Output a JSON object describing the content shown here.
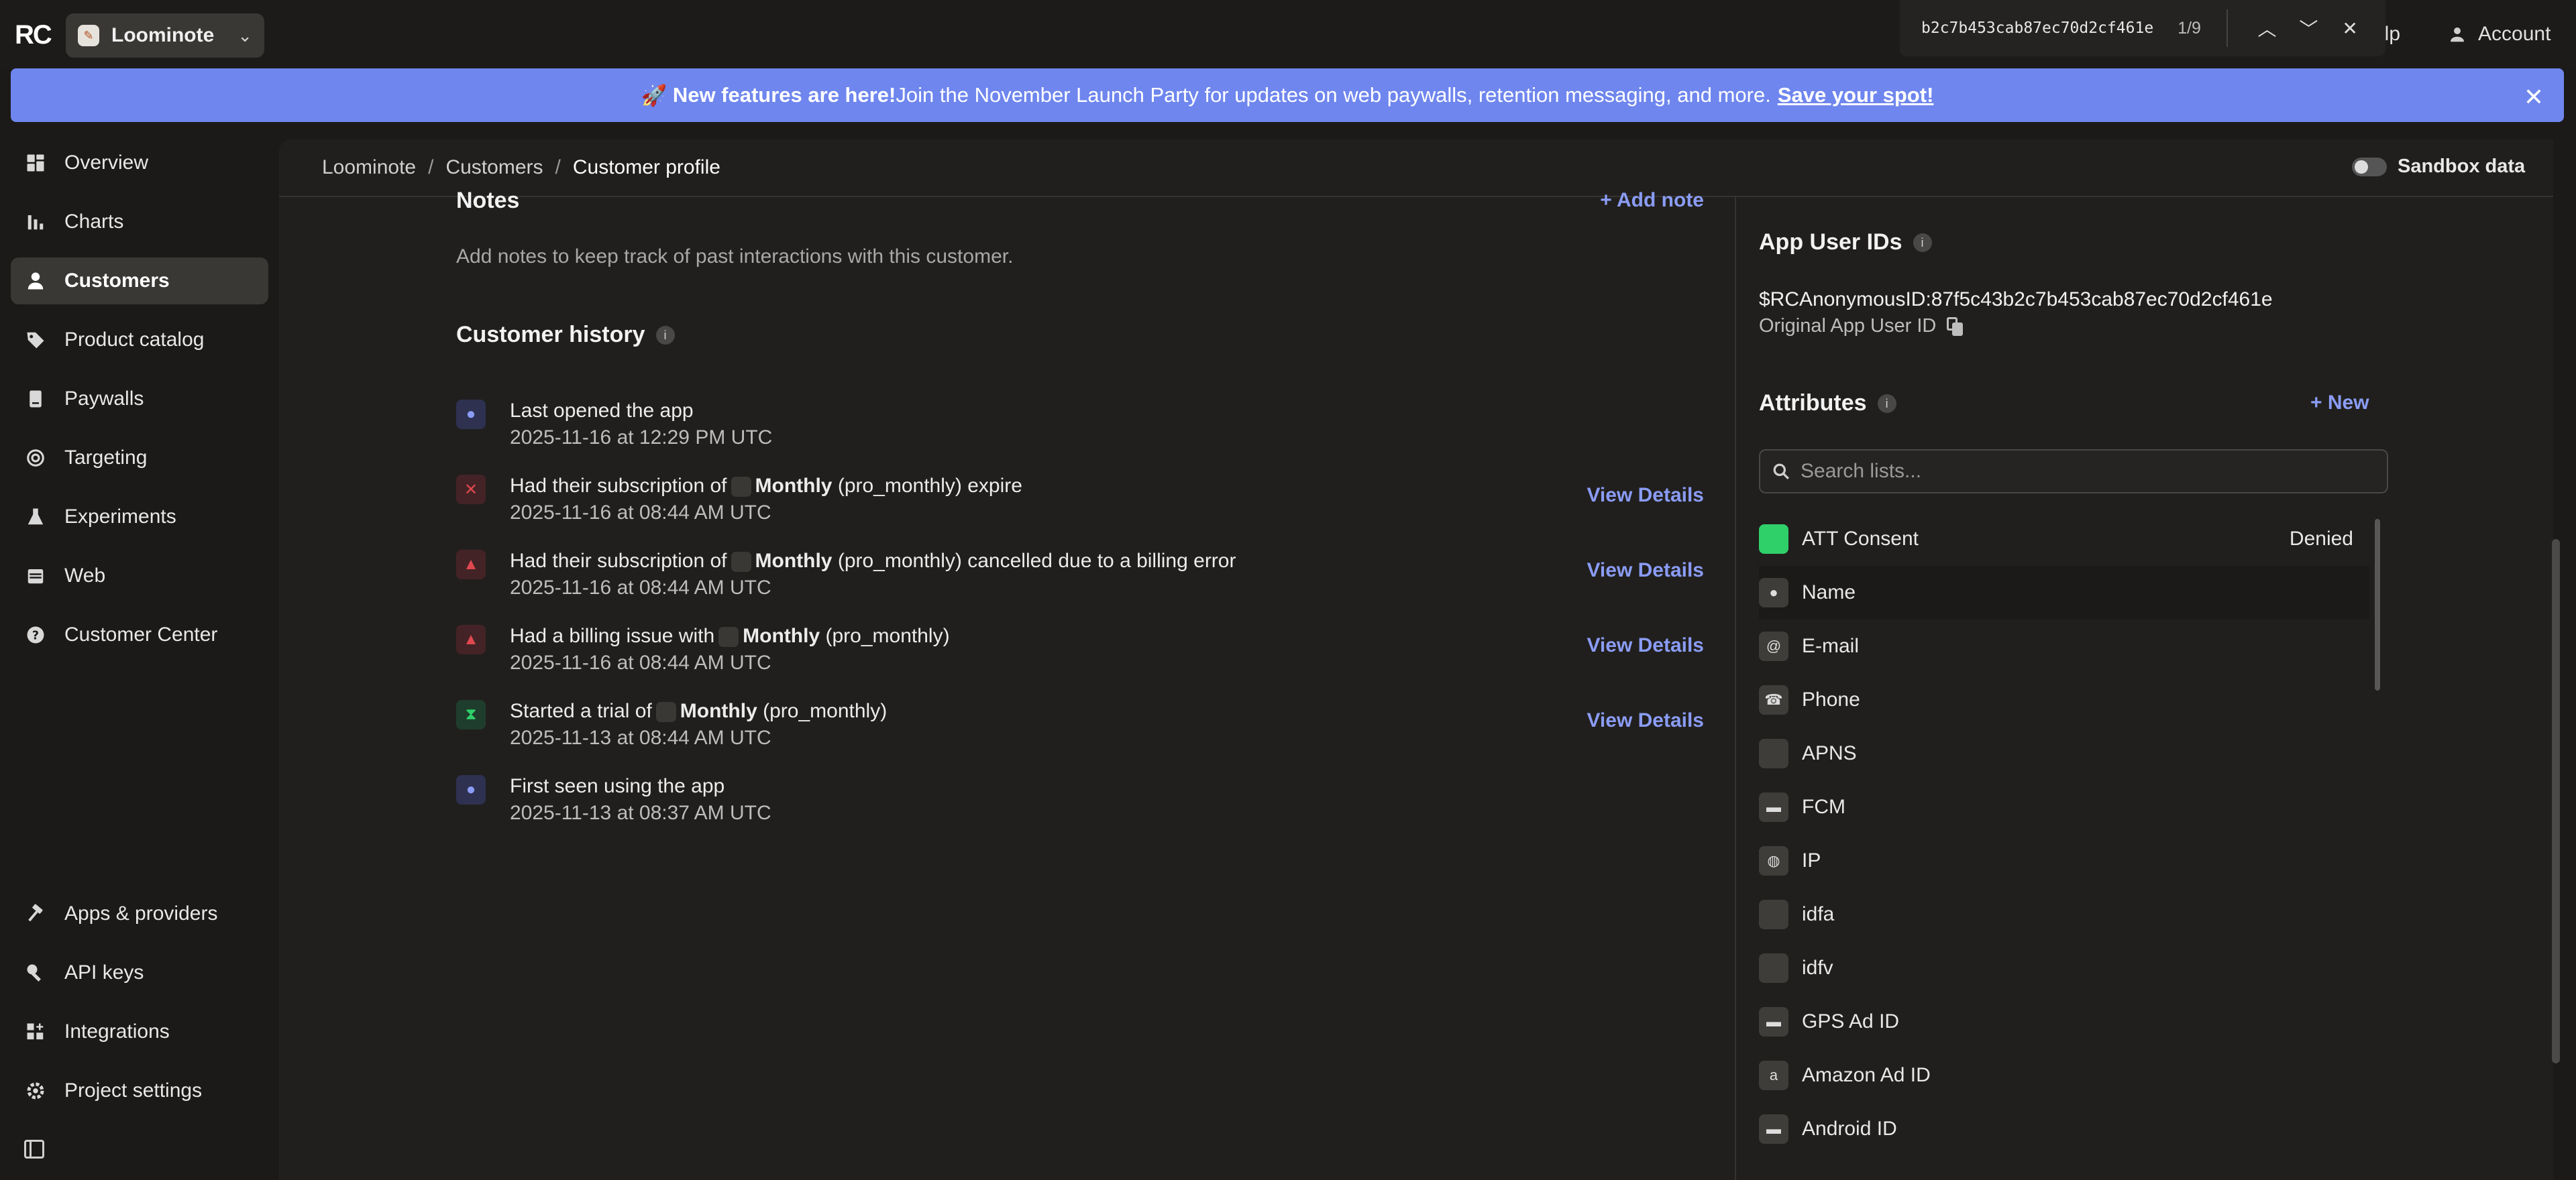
{
  "topbar": {
    "logo": "RC",
    "project_name": "Loominote",
    "help_label": "elp",
    "account_label": "Account"
  },
  "find_bar": {
    "query": "b2c7b453cab87ec70d2cf461e",
    "count": "1/9"
  },
  "banner": {
    "emoji": "🚀",
    "bold_text": "New features are here!",
    "text": " Join the November Launch Party for updates on web paywalls, retention messaging, and more.",
    "link": "Save your spot!"
  },
  "sidebar": {
    "items": [
      {
        "label": "Overview",
        "icon": "grid-icon"
      },
      {
        "label": "Charts",
        "icon": "bar-chart-icon"
      },
      {
        "label": "Customers",
        "icon": "user-icon",
        "active": true
      },
      {
        "label": "Product catalog",
        "icon": "tag-icon"
      },
      {
        "label": "Paywalls",
        "icon": "book-icon"
      },
      {
        "label": "Targeting",
        "icon": "target-icon"
      },
      {
        "label": "Experiments",
        "icon": "flask-icon"
      },
      {
        "label": "Web",
        "icon": "calendar-icon"
      },
      {
        "label": "Customer Center",
        "icon": "help-circle-icon"
      }
    ],
    "bottom_items": [
      {
        "label": "Apps & providers",
        "icon": "hammer-icon"
      },
      {
        "label": "API keys",
        "icon": "key-icon"
      },
      {
        "label": "Integrations",
        "icon": "grid-plus-icon"
      },
      {
        "label": "Project settings",
        "icon": "gear-icon"
      }
    ]
  },
  "breadcrumb": {
    "items": [
      "Loominote",
      "Customers"
    ],
    "current": "Customer profile"
  },
  "sandbox_label": "Sandbox data",
  "notes": {
    "title": "Notes",
    "add_label": "Add note",
    "empty_text": "Add notes to keep track of past interactions with this customer."
  },
  "history": {
    "title": "Customer history",
    "events": [
      {
        "type": "user",
        "text": "Last opened the app",
        "date": "2025-11-16 at 12:29 PM UTC",
        "details": ""
      },
      {
        "type": "expired",
        "pre": "Had their subscription of",
        "product": "Monthly",
        "post": "(pro_monthly) expire",
        "date": "2025-11-16 at 08:44 AM UTC",
        "details": "View Details"
      },
      {
        "type": "warning",
        "pre": "Had their subscription of",
        "product": "Monthly",
        "post": "(pro_monthly) cancelled due to a billing error",
        "date": "2025-11-16 at 08:44 AM UTC",
        "details": "View Details"
      },
      {
        "type": "warning",
        "pre": "Had a billing issue with",
        "product": "Monthly",
        "post": "(pro_monthly)",
        "date": "2025-11-16 at 08:44 AM UTC",
        "details": "View Details"
      },
      {
        "type": "trial",
        "pre": "Started a trial of",
        "product": "Monthly",
        "post": "(pro_monthly)",
        "date": "2025-11-13 at 08:44 AM UTC",
        "details": "View Details"
      },
      {
        "type": "user",
        "text": "First seen using the app",
        "date": "2025-11-13 at 08:37 AM UTC",
        "details": ""
      }
    ]
  },
  "app_user_ids": {
    "title": "App User IDs",
    "id_value": "$RCAnonymousID:87f5c43b2c7b453cab87ec70d2cf461e",
    "id_caption": "Original App User ID"
  },
  "attributes": {
    "title": "Attributes",
    "new_label": "New",
    "search_placeholder": "Search lists...",
    "rows": [
      {
        "name": "ATT Consent",
        "value": "Denied",
        "icon": "apple-icon"
      },
      {
        "name": "Name",
        "value": "",
        "icon": "person-icon"
      },
      {
        "name": "E-mail",
        "value": "",
        "icon": "at-icon"
      },
      {
        "name": "Phone",
        "value": "",
        "icon": "phone-icon"
      },
      {
        "name": "APNS",
        "value": "",
        "icon": "apple-icon"
      },
      {
        "name": "FCM",
        "value": "",
        "icon": "android-icon"
      },
      {
        "name": "IP",
        "value": "",
        "icon": "globe-icon"
      },
      {
        "name": "idfa",
        "value": "",
        "icon": "apple-icon"
      },
      {
        "name": "idfv",
        "value": "",
        "icon": "apple-icon"
      },
      {
        "name": "GPS Ad ID",
        "value": "",
        "icon": "android-icon"
      },
      {
        "name": "Amazon Ad ID",
        "value": "",
        "icon": "amazon-icon"
      },
      {
        "name": "Android ID",
        "value": "",
        "icon": "android-icon"
      }
    ]
  },
  "colors": {
    "accent": "#8a9cf5",
    "banner": "#6f86ee",
    "att_green": "#2fcf6a",
    "error_red": "#e0484f"
  }
}
